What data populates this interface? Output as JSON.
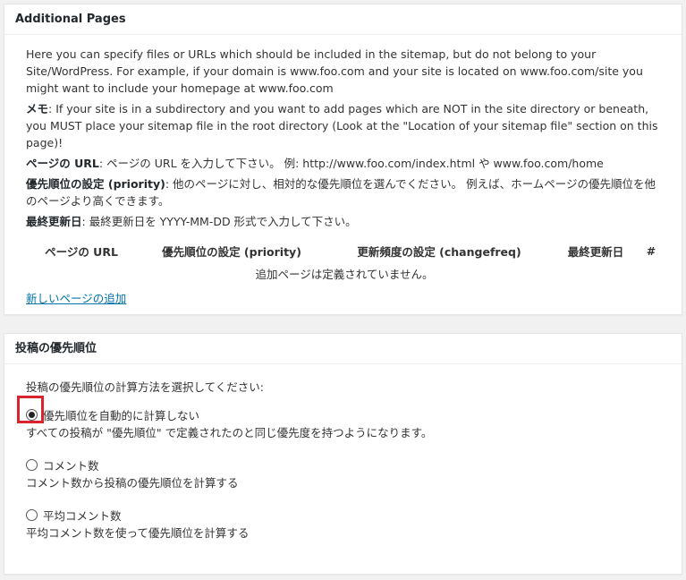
{
  "additional_pages": {
    "title": "Additional Pages",
    "intro": "Here you can specify files or URLs which should be included in the sitemap, but do not belong to your Site/WordPress. For example, if your domain is www.foo.com and your site is located on www.foo.com/site you might want to include your homepage at www.foo.com",
    "note_label": "メモ",
    "note_text": ": If your site is in a subdirectory and you want to add pages which are NOT in the site directory or beneath, you MUST place your sitemap file in the root directory (Look at the \"Location of your sitemap file\" section on this page)!",
    "url_label": "ページの URL",
    "url_text": ": ページの URL を入力して下さい。 例: http://www.foo.com/index.html や www.foo.com/home",
    "priority_label": "優先順位の設定 (priority)",
    "priority_text": ": 他のページに対し、相対的な優先順位を選んでください。 例えば、ホームページの優先順位を他のページより高くできます。",
    "lastmod_label": "最終更新日",
    "lastmod_text": ": 最終更新日を YYYY-MM-DD 形式で入力して下さい。",
    "table": {
      "headers": [
        "ページの URL",
        "優先順位の設定 (priority)",
        "更新頻度の設定 (changefreq)",
        "最終更新日",
        "#"
      ],
      "empty_message": "追加ページは定義されていません。"
    },
    "add_link": "新しいページの追加"
  },
  "post_priority": {
    "title": "投稿の優先順位",
    "intro": "投稿の優先順位の計算方法を選択してください:",
    "options": [
      {
        "label": "優先順位を自動的に計算しない",
        "desc": "すべての投稿が \"優先順位\" で定義されたのと同じ優先度を持つようになります。",
        "checked": true
      },
      {
        "label": "コメント数",
        "desc": "コメント数から投稿の優先順位を計算する",
        "checked": false
      },
      {
        "label": "平均コメント数",
        "desc": "平均コメント数を使って優先順位を計算する",
        "checked": false
      }
    ]
  },
  "colors": {
    "link": "#0073aa",
    "highlight": "#d9232e",
    "background": "#f1f1f1"
  }
}
